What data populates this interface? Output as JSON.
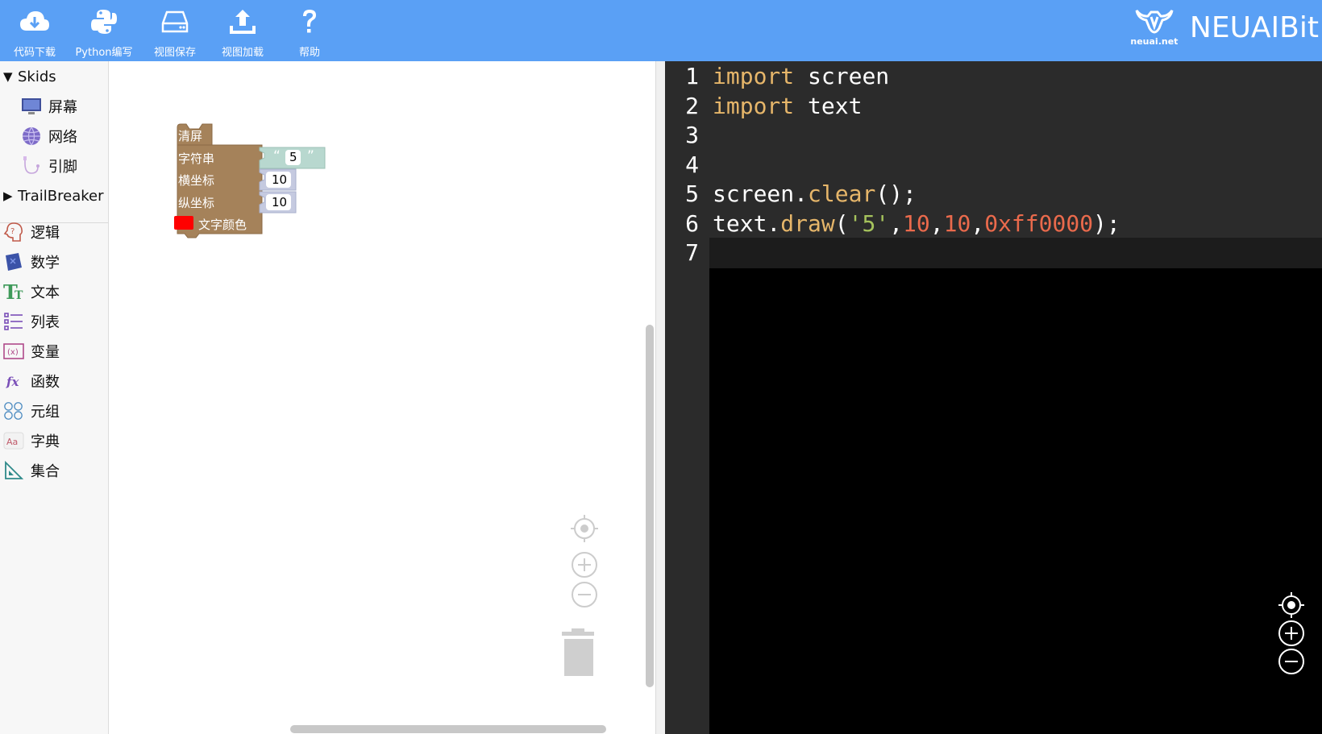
{
  "toolbar": {
    "items": [
      {
        "label": "代码下载",
        "icon": "cloud-download-icon"
      },
      {
        "label": "Python编写",
        "icon": "python-icon"
      },
      {
        "label": "视图保存",
        "icon": "hard-drive-icon"
      },
      {
        "label": "视图加载",
        "icon": "upload-icon"
      },
      {
        "label": "帮助",
        "icon": "help-icon"
      }
    ],
    "brand_small": "neuai.net",
    "brand_text": "NEUAIBit",
    "bg_color": "#5aa0f5"
  },
  "toolbox": {
    "groups": [
      {
        "label": "Skids",
        "expanded": true,
        "items": [
          {
            "label": "屏幕",
            "icon": "monitor-icon"
          },
          {
            "label": "网络",
            "icon": "globe-icon"
          },
          {
            "label": "引脚",
            "icon": "pin-cable-icon"
          }
        ]
      },
      {
        "label": "TrailBreaker",
        "expanded": false
      }
    ],
    "categories": [
      {
        "label": "逻辑",
        "icon": "logic-icon"
      },
      {
        "label": "数学",
        "icon": "math-icon"
      },
      {
        "label": "文本",
        "icon": "text-icon"
      },
      {
        "label": "列表",
        "icon": "list-icon"
      },
      {
        "label": "变量",
        "icon": "variable-icon"
      },
      {
        "label": "函数",
        "icon": "function-icon"
      },
      {
        "label": "元组",
        "icon": "tuple-icon"
      },
      {
        "label": "字典",
        "icon": "dictionary-icon"
      },
      {
        "label": "集合",
        "icon": "set-icon"
      }
    ]
  },
  "workspace": {
    "blocks": {
      "clear_label": "清屏",
      "string_label": "字符串",
      "string_value": "5",
      "quote_open": "“",
      "quote_close": "”",
      "x_label": "横坐标",
      "x_value": "10",
      "y_label": "纵坐标",
      "y_value": "10",
      "color_label": "文字颜色",
      "color_swatch": "#ff0000",
      "block_color": "#a5825a",
      "text_block_color": "#b8d8cf",
      "num_block_color": "#c5cae0"
    }
  },
  "editor": {
    "line_numbers": [
      "1",
      "2",
      "3",
      "4",
      "5",
      "6",
      "7"
    ],
    "active_line": 7,
    "lines": [
      [
        {
          "t": "import",
          "c": "kw"
        },
        {
          "t": " screen",
          "c": "pl"
        }
      ],
      [
        {
          "t": "import",
          "c": "kw"
        },
        {
          "t": " text",
          "c": "pl"
        }
      ],
      [],
      [],
      [
        {
          "t": "screen.",
          "c": "pl"
        },
        {
          "t": "clear",
          "c": "fn"
        },
        {
          "t": "();",
          "c": "pl"
        }
      ],
      [
        {
          "t": "text.",
          "c": "pl"
        },
        {
          "t": "draw",
          "c": "fn"
        },
        {
          "t": "(",
          "c": "pl"
        },
        {
          "t": "'5'",
          "c": "str"
        },
        {
          "t": ",",
          "c": "pl"
        },
        {
          "t": "10",
          "c": "num"
        },
        {
          "t": ",",
          "c": "pl"
        },
        {
          "t": "10",
          "c": "num"
        },
        {
          "t": ",",
          "c": "pl"
        },
        {
          "t": "0xff0000",
          "c": "num"
        },
        {
          "t": ");",
          "c": "pl"
        }
      ],
      []
    ]
  }
}
